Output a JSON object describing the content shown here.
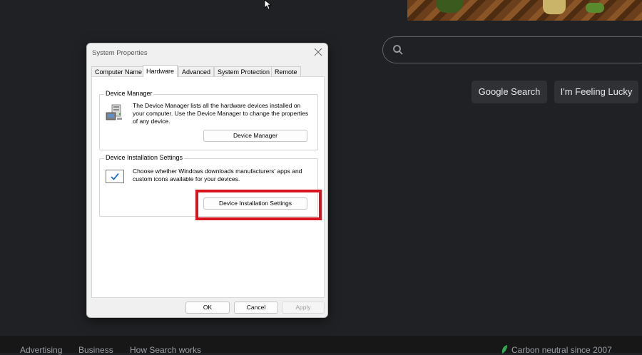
{
  "browser": {
    "search_button": "Google Search",
    "lucky_button": "I'm Feeling Lucky",
    "footer": {
      "advertising": "Advertising",
      "business": "Business",
      "how_search_works": "How Search works",
      "carbon": "Carbon neutral since 2007"
    }
  },
  "dialog": {
    "title": "System Properties",
    "tabs": [
      "Computer Name",
      "Hardware",
      "Advanced",
      "System Protection",
      "Remote"
    ],
    "active_tab": "Hardware",
    "device_manager": {
      "group_title": "Device Manager",
      "description": "The Device Manager lists all the hardware devices installed on your computer. Use the Device Manager to change the properties of any device.",
      "button": "Device Manager"
    },
    "device_installation": {
      "group_title": "Device Installation Settings",
      "description": "Choose whether Windows downloads manufacturers' apps and custom icons available for your devices.",
      "button": "Device Installation Settings"
    },
    "buttons": {
      "ok": "OK",
      "cancel": "Cancel",
      "apply": "Apply"
    }
  },
  "colors": {
    "page_background": "#202124",
    "highlight": "#d9141e",
    "checkmark": "#1e6fd0"
  }
}
